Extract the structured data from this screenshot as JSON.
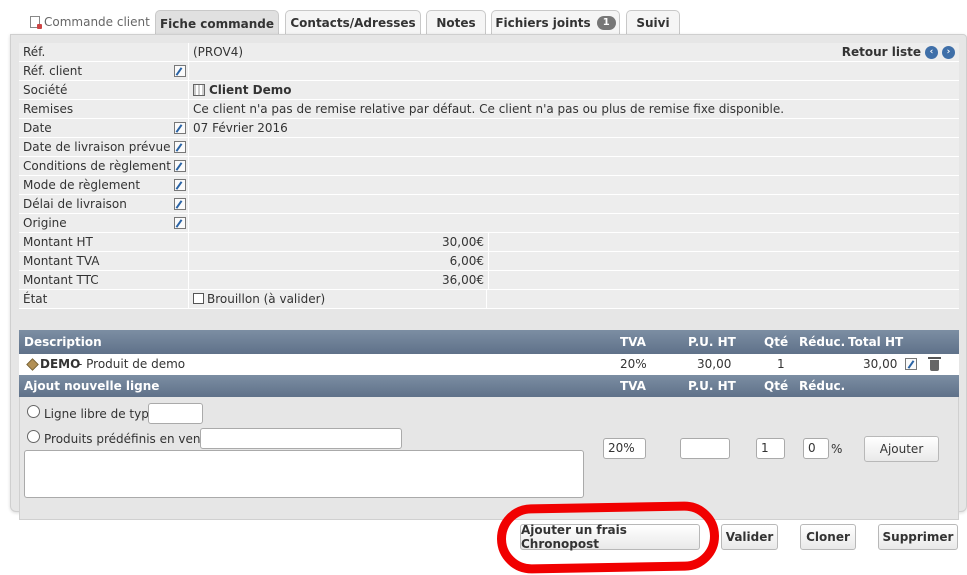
{
  "tabs": {
    "commande_client": "Commande client",
    "fiche_commande": "Fiche commande",
    "contacts": "Contacts/Adresses",
    "notes": "Notes",
    "fichiers": "Fichiers joints",
    "fichiers_count": "1",
    "suivi": "Suivi"
  },
  "fields": {
    "ref_label": "Réf.",
    "ref_value": "(PROV4)",
    "retour_liste": "Retour liste",
    "ref_client_label": "Réf. client",
    "societe_label": "Société",
    "societe_value": "Client Demo",
    "remises_label": "Remises",
    "remises_value": "Ce client n'a pas de remise relative par défaut. Ce client n'a pas ou plus de remise fixe disponible.",
    "date_label": "Date",
    "date_value": "07 Février 2016",
    "date_livraison_label": "Date de livraison prévue",
    "conditions_label": "Conditions de règlement",
    "mode_label": "Mode de règlement",
    "delai_label": "Délai de livraison",
    "origine_label": "Origine",
    "montant_ht_label": "Montant HT",
    "montant_ht_value": "30,00€",
    "montant_tva_label": "Montant TVA",
    "montant_tva_value": "6,00€",
    "montant_ttc_label": "Montant TTC",
    "montant_ttc_value": "36,00€",
    "etat_label": "État",
    "etat_value": "Brouillon (à valider)"
  },
  "lines": {
    "headers": {
      "description": "Description",
      "tva": "TVA",
      "pu_ht": "P.U. HT",
      "qte": "Qté",
      "reduc": "Réduc.",
      "total_ht": "Total HT"
    },
    "rows": [
      {
        "ref": "DEMO",
        "label": " - Produit de demo",
        "tva": "20%",
        "pu_ht": "30,00",
        "qte": "1",
        "total_ht": "30,00"
      }
    ]
  },
  "new_line": {
    "title": "Ajout nouvelle ligne",
    "tva": "TVA",
    "pu_ht": "P.U. HT",
    "qte": "Qté",
    "reduc": "Réduc.",
    "libre_label": "Ligne libre de type",
    "predefinis_label": "Produits prédéfinis en vente",
    "tva_value": "20%",
    "pu_value": "",
    "qte_value": "1",
    "reduc_value": "0",
    "percent": "%",
    "ajouter": "Ajouter"
  },
  "actions": {
    "chronopost": "Ajouter un frais Chronopost",
    "valider": "Valider",
    "cloner": "Cloner",
    "supprimer": "Supprimer"
  },
  "colors": {
    "header_bg": "#6b7d94",
    "annotation_red": "#f10000"
  }
}
